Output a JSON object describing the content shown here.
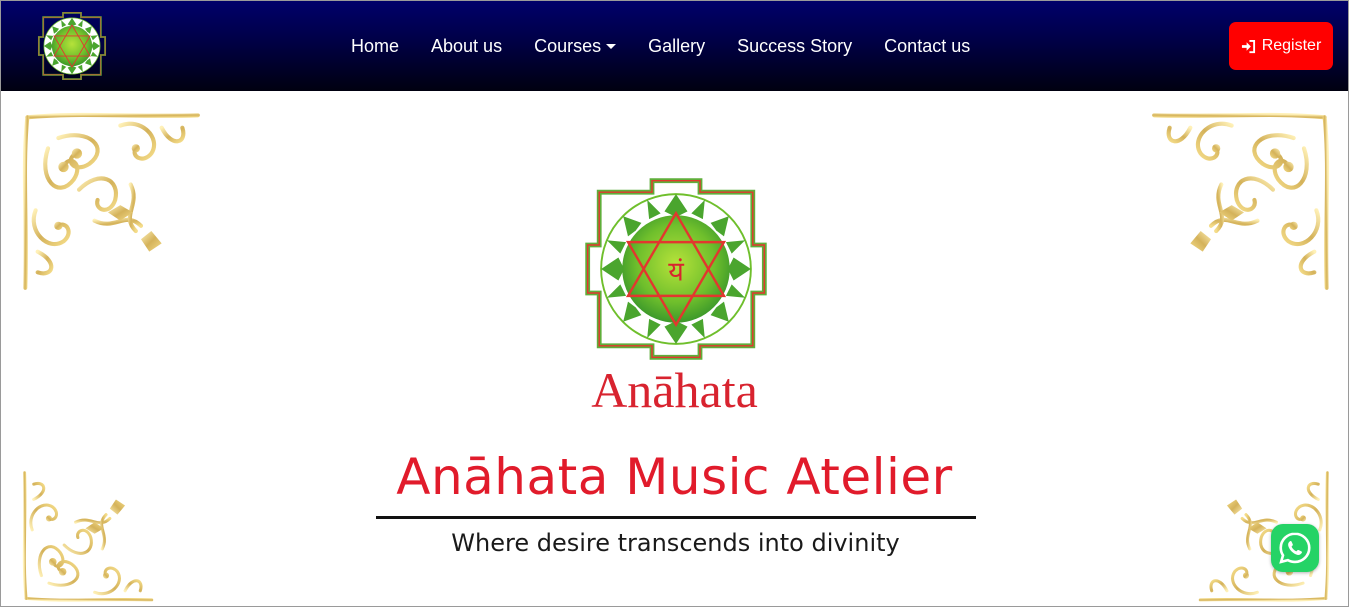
{
  "nav": {
    "home": "Home",
    "about": "About us",
    "courses": "Courses",
    "gallery": "Gallery",
    "success": "Success Story",
    "contact": "Contact us",
    "register": "Register",
    "register_icon": "sign-in-icon"
  },
  "hero": {
    "logo_glyph": "यं",
    "logo_word": "Anāhata",
    "title": "Anāhata Music Atelier",
    "tagline": "Where desire transcends into divinity"
  },
  "colors": {
    "nav_top": "#00006a",
    "nav_bottom": "#000010",
    "register_bg": "#ff0000",
    "brand_red": "#d8232f",
    "gold": "#d4b25a",
    "whatsapp": "#25d366"
  },
  "icons": {
    "whatsapp": "whatsapp-icon"
  }
}
